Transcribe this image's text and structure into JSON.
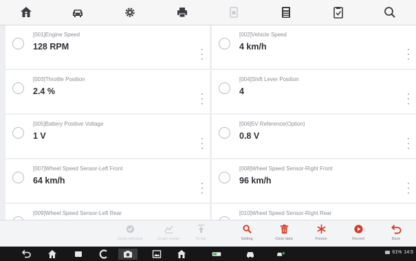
{
  "toolbar": {
    "icons": [
      "home-icon",
      "vehicle-icon",
      "settings-icon",
      "print-icon",
      "help-icon",
      "save-icon",
      "report-icon",
      "search-icon"
    ]
  },
  "colors": {
    "accent_red": "#d73b25",
    "top_icon": "#3a3c40",
    "disabled_icon": "#c9ccd0"
  },
  "parameters": [
    {
      "name": "[001]Engine Speed",
      "value": "128 RPM"
    },
    {
      "name": "[002]Vehicle Speed",
      "value": "4 km/h"
    },
    {
      "name": "[003]Throttle Position",
      "value": "2.4 %"
    },
    {
      "name": "[004]Shift Lever Position",
      "value": "4"
    },
    {
      "name": "[005]Battery Positive Voltage",
      "value": "1 V"
    },
    {
      "name": "[006]5V Reference(Option)",
      "value": "0.8 V"
    },
    {
      "name": "[007]Wheel Speed Sensor-Left Front",
      "value": "64 km/h"
    },
    {
      "name": "[008]Wheel Speed Sensor-Right Front",
      "value": "96 km/h"
    },
    {
      "name": "[009]Wheel Speed Sensor-Left Rear",
      "value": ""
    },
    {
      "name": "[010]Wheel Speed Sensor-Right Rear",
      "value": ""
    }
  ],
  "functions": [
    {
      "label": "Show selected",
      "icon": "show-selected-icon",
      "enabled": false
    },
    {
      "label": "Graph merge",
      "icon": "graph-merge-icon",
      "enabled": false
    },
    {
      "label": "To top",
      "icon": "to-top-icon",
      "enabled": false
    },
    {
      "label": "Setting",
      "icon": "setting-icon",
      "enabled": true
    },
    {
      "label": "Clear data",
      "icon": "clear-data-icon",
      "enabled": true
    },
    {
      "label": "Freeze",
      "icon": "freeze-icon",
      "enabled": true
    },
    {
      "label": "Record",
      "icon": "record-icon",
      "enabled": true
    },
    {
      "label": "Back",
      "icon": "back-icon",
      "enabled": true
    }
  ],
  "navbar": {
    "icons": [
      "back-arrow-icon",
      "home-icon",
      "tasks-icon",
      "browser-icon",
      "camera-icon",
      "gallery-icon",
      "shop-home-icon",
      "vci-icon",
      "car-icon",
      "car-connect-icon"
    ],
    "battery": "61%",
    "time": "14:5"
  }
}
